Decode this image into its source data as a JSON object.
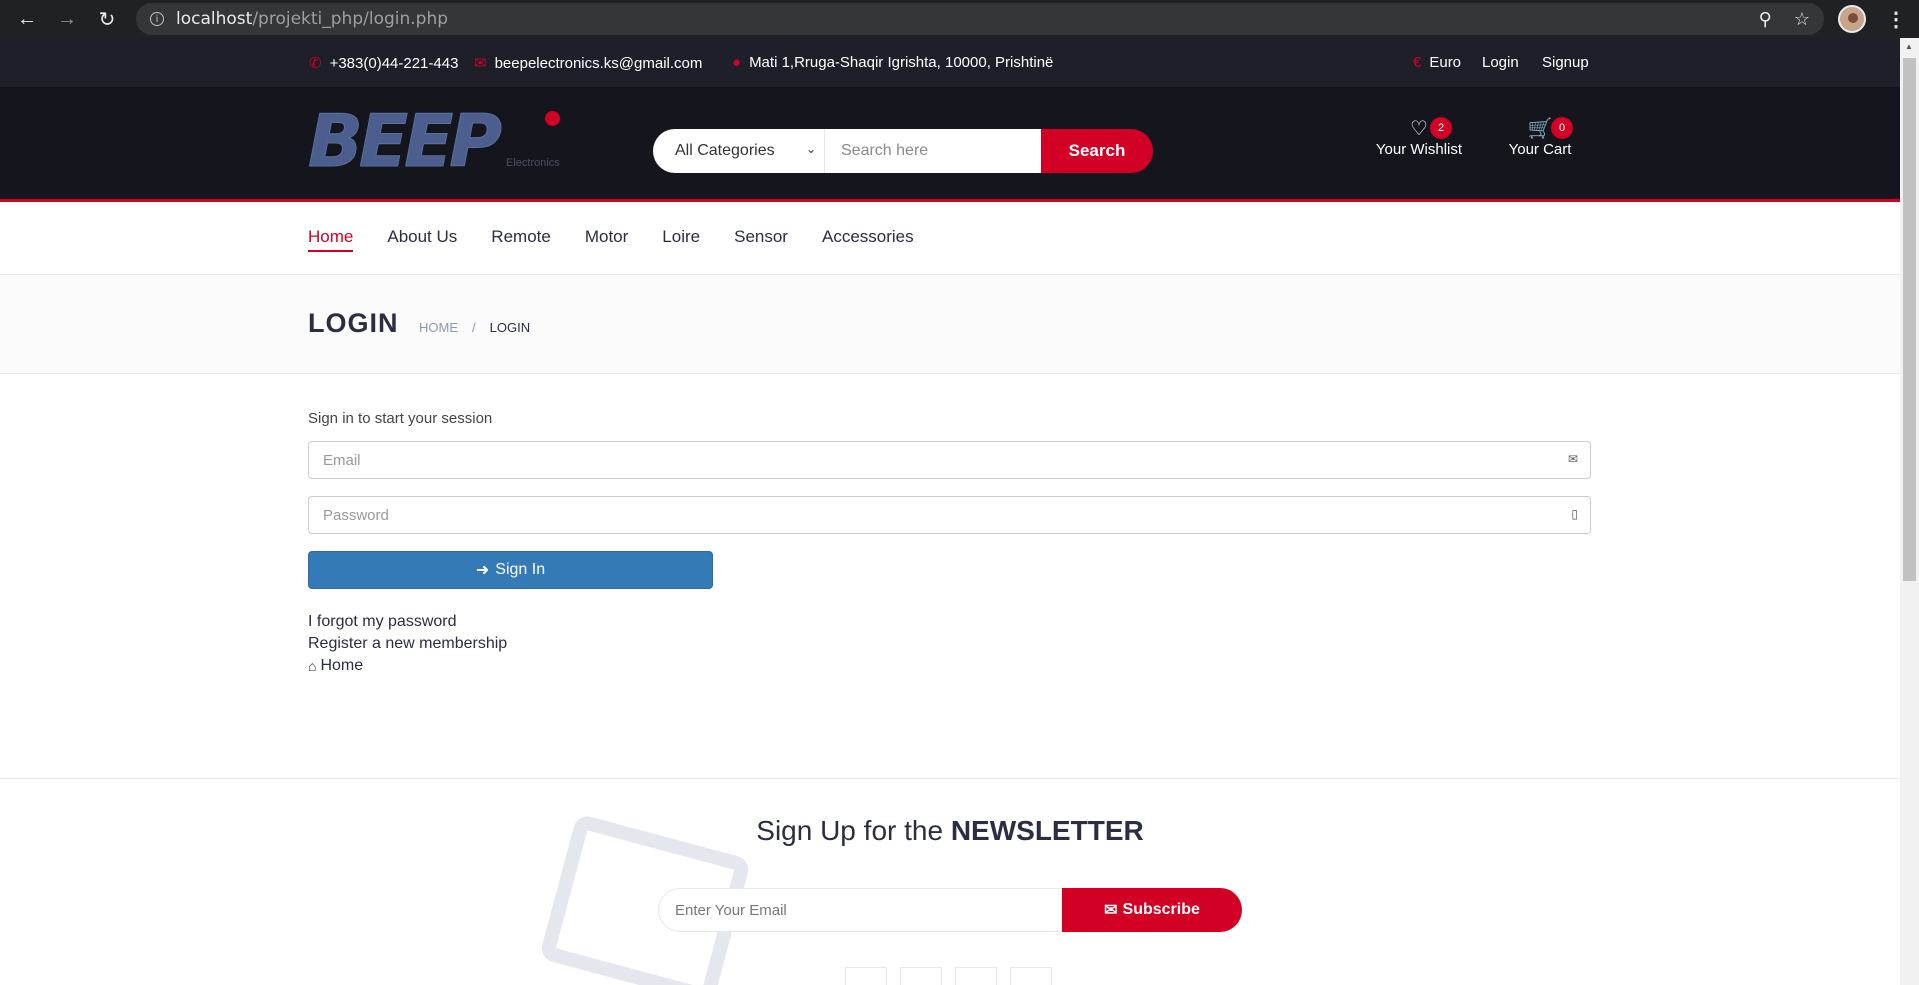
{
  "browser": {
    "url_host": "localhost",
    "url_path": "/projekti_php/login.php"
  },
  "top_strip": {
    "phone": "+383(0)44-221-443",
    "email": "beepelectronics.ks@gmail.com",
    "address": "Mati 1,Rruga-Shaqir Igrishta, 10000, Prishtinë",
    "currency": "Euro",
    "login": "Login",
    "signup": "Signup"
  },
  "header": {
    "logo_text": "BEEP",
    "logo_sub": "Electronics",
    "category_selected": "All Categories",
    "search_placeholder": "Search here",
    "search_button": "Search",
    "wishlist_label": "Your Wishlist",
    "wishlist_count": "2",
    "cart_label": "Your Cart",
    "cart_count": "0"
  },
  "nav": {
    "items": [
      "Home",
      "About Us",
      "Remote",
      "Motor",
      "Loire",
      "Sensor",
      "Accessories"
    ]
  },
  "breadcrumb": {
    "title": "LOGIN",
    "home": "HOME",
    "separator": "/",
    "current": "LOGIN"
  },
  "login": {
    "message": "Sign in to start your session",
    "email_placeholder": "Email",
    "password_placeholder": "Password",
    "signin_button": "Sign In",
    "forgot_link": "I forgot my password",
    "register_link": "Register a new membership",
    "home_link": "Home"
  },
  "newsletter": {
    "heading_prefix": "Sign Up for the ",
    "heading_bold": "NEWSLETTER",
    "email_placeholder": "Enter Your Email",
    "subscribe_button": "Subscribe"
  },
  "colors": {
    "accent": "#d10024",
    "dark_header": "#15161d",
    "top_strip": "#1e1f29",
    "signin_blue": "#337ab7"
  }
}
